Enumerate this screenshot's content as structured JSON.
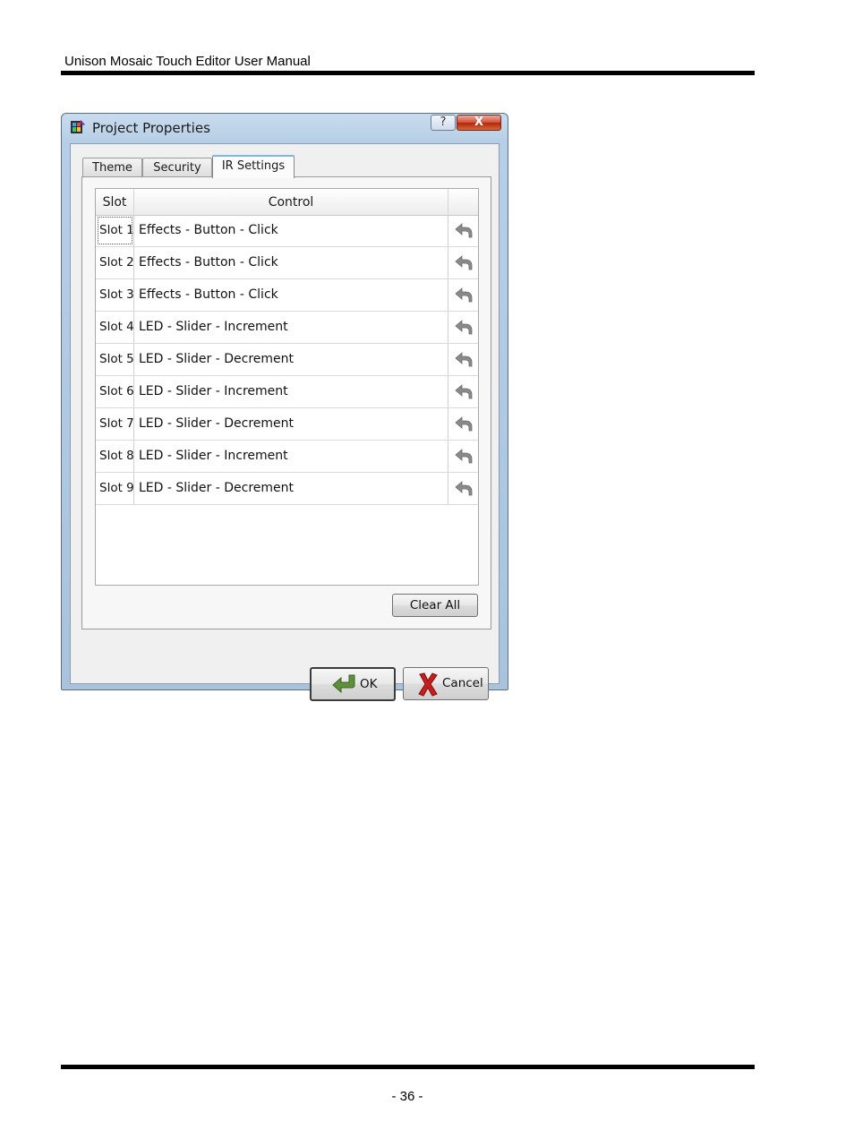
{
  "page": {
    "header": "Unison Mosaic Touch Editor User Manual",
    "page_number": "- 36 -"
  },
  "window": {
    "title": "Project Properties",
    "help_label": "?",
    "close_label": "X",
    "tabs": [
      {
        "label": "Theme",
        "active": false
      },
      {
        "label": "Security",
        "active": false
      },
      {
        "label": "IR Settings",
        "active": true
      }
    ],
    "table": {
      "columns": [
        "Slot",
        "Control",
        ""
      ],
      "rows": [
        {
          "slot": "Slot 1",
          "control": "Effects - Button - Click"
        },
        {
          "slot": "Slot 2",
          "control": "Effects - Button - Click"
        },
        {
          "slot": "Slot 3",
          "control": "Effects - Button - Click"
        },
        {
          "slot": "Slot 4",
          "control": "LED - Slider - Increment"
        },
        {
          "slot": "Slot 5",
          "control": "LED - Slider - Decrement"
        },
        {
          "slot": "Slot 6",
          "control": "LED - Slider - Increment"
        },
        {
          "slot": "Slot 7",
          "control": "LED - Slider - Decrement"
        },
        {
          "slot": "Slot 8",
          "control": "LED - Slider - Increment"
        },
        {
          "slot": "Slot 9",
          "control": "LED - Slider - Decrement"
        }
      ],
      "row_action_icon": "undo-arrow-icon"
    },
    "buttons": {
      "clear_all": "Clear All",
      "ok": "OK",
      "cancel": "Cancel"
    },
    "icons": {
      "app": "app-icon",
      "ok": "green-check-arrow-icon",
      "cancel": "red-x-icon"
    }
  },
  "colors": {
    "titlebar": "#b7cfe6",
    "close_button": "#c73a1c",
    "active_tab_highlight": "#7eb4ea"
  }
}
